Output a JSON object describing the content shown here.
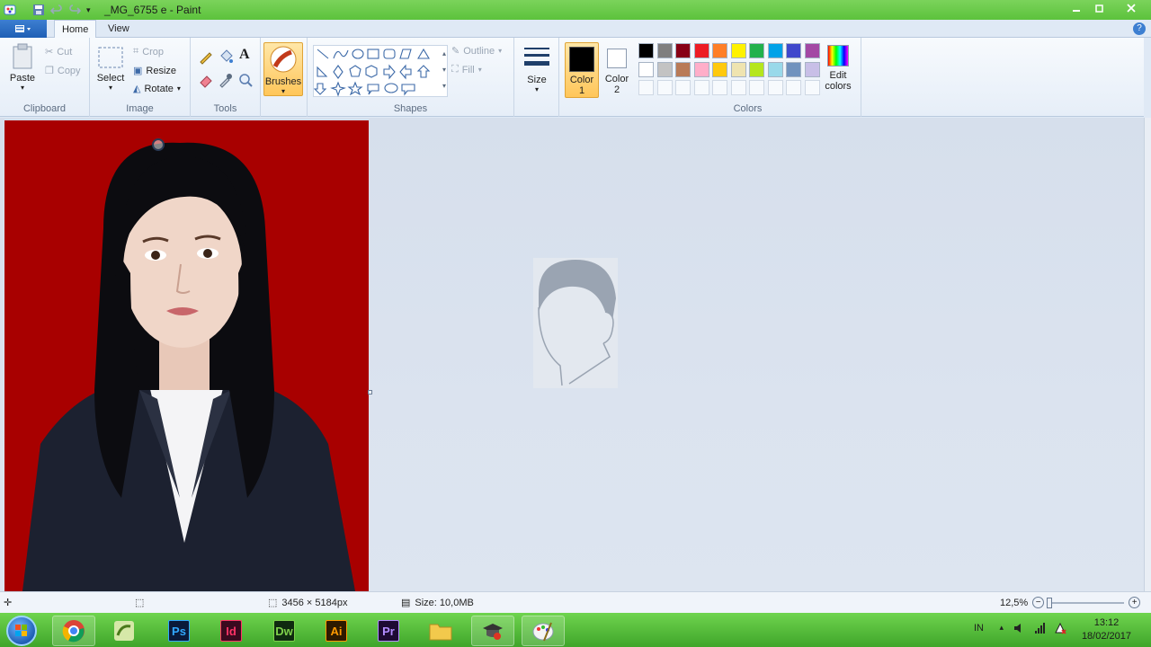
{
  "window": {
    "title": "_MG_6755 e - Paint"
  },
  "tabs": [
    {
      "label": "Home"
    },
    {
      "label": "View"
    }
  ],
  "clipboard": {
    "paste": "Paste",
    "cut": "Cut",
    "copy": "Copy",
    "label": "Clipboard"
  },
  "image": {
    "crop": "Crop",
    "resize": "Resize",
    "rotate": "Rotate",
    "select": "Select",
    "label": "Image"
  },
  "tools": {
    "label": "Tools"
  },
  "brushes": {
    "label": "Brushes"
  },
  "shapes": {
    "label": "Shapes",
    "outline": "Outline",
    "fill": "Fill"
  },
  "size": {
    "label": "Size"
  },
  "color1": {
    "line1": "Color",
    "line2": "1",
    "value": "#000000"
  },
  "color2": {
    "line1": "Color",
    "line2": "2",
    "value": "#ffffff"
  },
  "colors": {
    "label": "Colors",
    "edit_line1": "Edit",
    "edit_line2": "colors",
    "row1": [
      "#000000",
      "#7f7f7f",
      "#880015",
      "#ed1c24",
      "#ff7f27",
      "#fff200",
      "#22b14c",
      "#00a2e8",
      "#3f48cc",
      "#a349a4"
    ],
    "row2": [
      "#ffffff",
      "#c3c3c3",
      "#b97a57",
      "#ffaec9",
      "#ffc90e",
      "#efe4b0",
      "#b5e61d",
      "#99d9ea",
      "#7092be",
      "#c8bfe7"
    ]
  },
  "status": {
    "dimensions": "3456 × 5184px",
    "size": "Size: 10,0MB",
    "zoom": "12,5%"
  },
  "taskbar": {
    "apps": [
      {
        "name": "chrome",
        "text": ""
      },
      {
        "name": "bridge",
        "text": ""
      },
      {
        "name": "photoshop",
        "text": "Ps",
        "bg": "#0a1a3a",
        "fg": "#31a8ff"
      },
      {
        "name": "indesign",
        "text": "Id",
        "bg": "#3a0a1f",
        "fg": "#ff3366"
      },
      {
        "name": "dreamweaver",
        "text": "Dw",
        "bg": "#0f2a10",
        "fg": "#7fd14b"
      },
      {
        "name": "illustrator",
        "text": "Ai",
        "bg": "#2e1a00",
        "fg": "#ff9a00"
      },
      {
        "name": "premiere",
        "text": "Pr",
        "bg": "#1d0a33",
        "fg": "#b28cff"
      }
    ],
    "lang": "IN",
    "time": "13:12",
    "date": "18/02/2017"
  }
}
